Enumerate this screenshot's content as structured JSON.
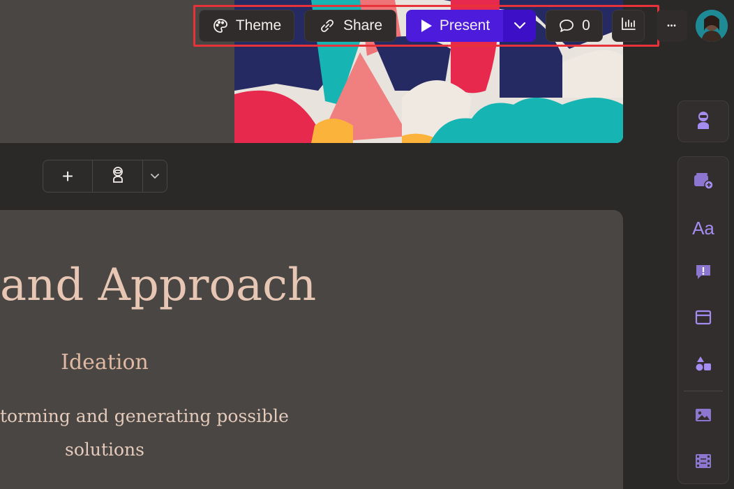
{
  "toolbar": {
    "theme_label": "Theme",
    "share_label": "Share",
    "present_label": "Present",
    "comments_count": "0",
    "more_label": "•••"
  },
  "slide": {
    "title": "and Approach",
    "subtitle": "Ideation",
    "body_line1": "torming and generating possible",
    "body_line2": "solutions"
  },
  "block_tools": {
    "add_label": "+"
  },
  "colors": {
    "accent": "#4d1bdb",
    "highlight_border": "#e8323a",
    "rail_icon": "#a58cf0"
  },
  "icons": {
    "theme": "palette-icon",
    "share": "link-icon",
    "present": "play-icon",
    "comments": "comment-icon",
    "analytics": "bar-chart-icon",
    "ai": "robot-icon",
    "rail": [
      "add-card-icon",
      "text-styles-icon",
      "callout-icon",
      "layout-icon",
      "shapes-icon",
      "image-icon",
      "video-icon"
    ]
  }
}
